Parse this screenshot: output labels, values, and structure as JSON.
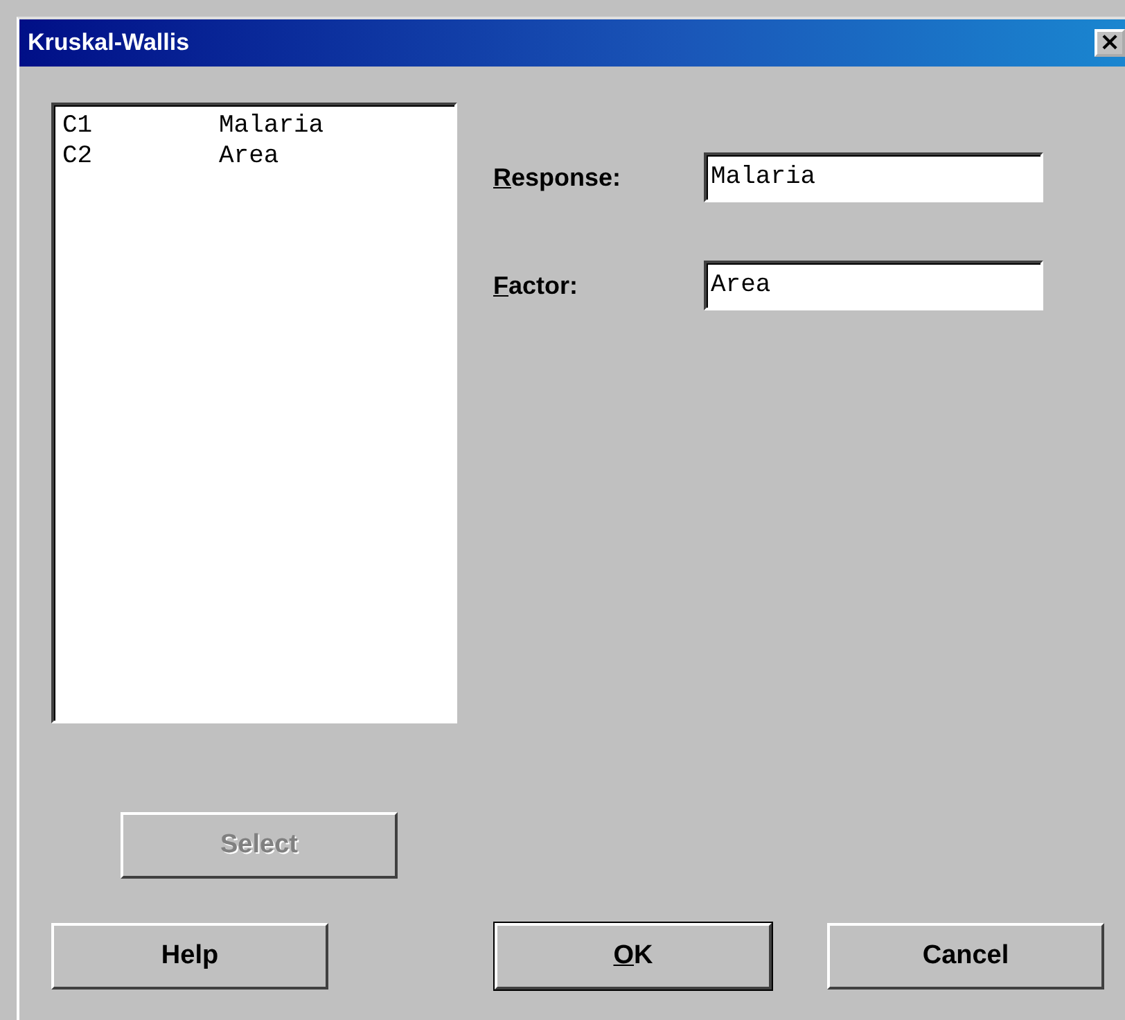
{
  "window": {
    "title": "Kruskal-Wallis",
    "close_symbol": "×"
  },
  "variables": [
    {
      "column": "C1",
      "name": "Malaria"
    },
    {
      "column": "C2",
      "name": "Area"
    }
  ],
  "fields": [
    {
      "mnemonic": "R",
      "label_rest": "esponse:",
      "value": "Malaria"
    },
    {
      "mnemonic": "F",
      "label_rest": "actor:",
      "value": "Area"
    }
  ],
  "select_button": {
    "label": "Select",
    "disabled": true
  },
  "buttons": [
    {
      "label": "Help",
      "default": false
    },
    {
      "mnemonic": "O",
      "label_rest": "K",
      "default": true
    },
    {
      "label": "Cancel",
      "default": false
    }
  ]
}
